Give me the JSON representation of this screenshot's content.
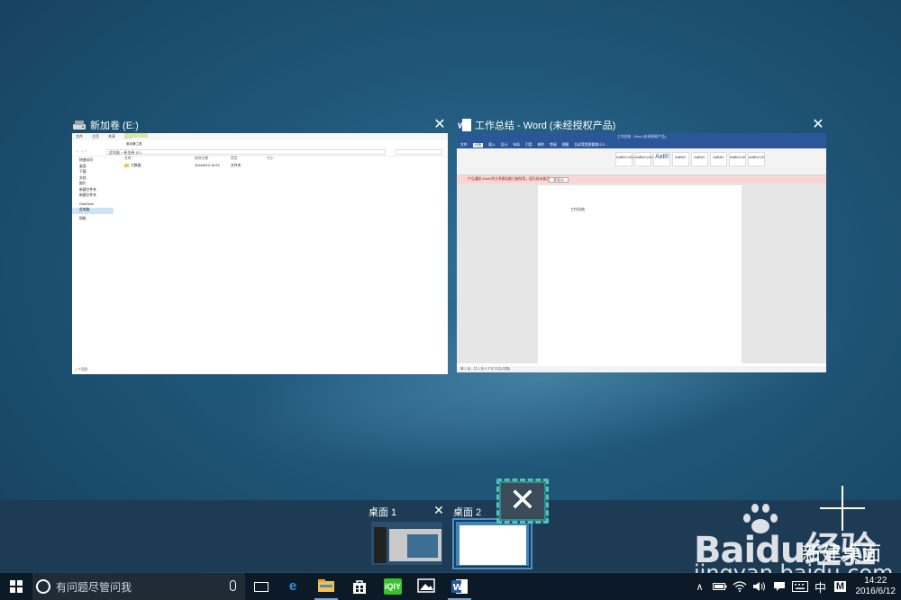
{
  "windows": [
    {
      "id": "explorer",
      "title": "新加卷 (E:)"
    },
    {
      "id": "word",
      "title": "工作总结 - Word (未经授权产品)"
    }
  ],
  "explorer": {
    "tabs": [
      "文件",
      "主页",
      "共享",
      "查看"
    ],
    "manage_tab": "驱动器工具",
    "address": "此电脑 > 新加卷 (E:)",
    "nav_items": [
      "快速访问",
      "桌面",
      "下载",
      "文档",
      "图片",
      "新建文件夹",
      "新建文件夹",
      "OneDrive",
      "此电脑",
      "网络"
    ],
    "columns": [
      "名称",
      "修改日期",
      "类型",
      "大小"
    ],
    "rows": [
      {
        "name": "大数据",
        "date": "2016/6/13 19:23",
        "type": "文件夹"
      }
    ],
    "status": "1 个项目"
  },
  "word": {
    "doc_title": "工作总结 - Word (未经授权产品)",
    "tabs": [
      "文件",
      "开始",
      "插入",
      "设计",
      "布局",
      "引用",
      "邮件",
      "审阅",
      "视图",
      "告诉我您想要做什么..."
    ],
    "styles": [
      "AaBbCcDc",
      "AaBbCcDc",
      "AaBl",
      "AaBbC",
      "AaBbC",
      "AaBbC",
      "AaBbCcD",
      "AaBbCcD"
    ],
    "notice": "产品通知  Word 的大多数功能已被禁用，因为尚未激活。",
    "notice_button": "激活(A)",
    "page_text": "工作总结",
    "status": "第 1 页，共 1 页  0 个字  中文(中国)"
  },
  "desktops": [
    {
      "label": "桌面 1"
    },
    {
      "label": "桌面 2"
    }
  ],
  "new_desktop": {
    "label": "新建桌面"
  },
  "watermark": {
    "brand": "Baidu经验",
    "url": "jingyan.baidu.com"
  },
  "taskbar": {
    "search_placeholder": "有问题尽管问我",
    "apps": [
      {
        "icon": "edge-icon",
        "glyph": "e",
        "color": "#3b8fd9"
      },
      {
        "icon": "file-explorer-icon",
        "glyph": "▬",
        "color": "#f2c14e"
      },
      {
        "icon": "store-icon",
        "glyph": "⊞",
        "color": "#ffffff"
      },
      {
        "icon": "iqiyi-icon",
        "glyph": "iQ",
        "color": "#36c22c"
      },
      {
        "icon": "photos-icon",
        "glyph": "▲",
        "color": "#ffffff"
      },
      {
        "icon": "word-icon",
        "glyph": "W",
        "color": "#2b579a"
      }
    ],
    "ime_mode": "中",
    "ime_m": "M",
    "time": "14:22",
    "date": "2016/6/12"
  }
}
